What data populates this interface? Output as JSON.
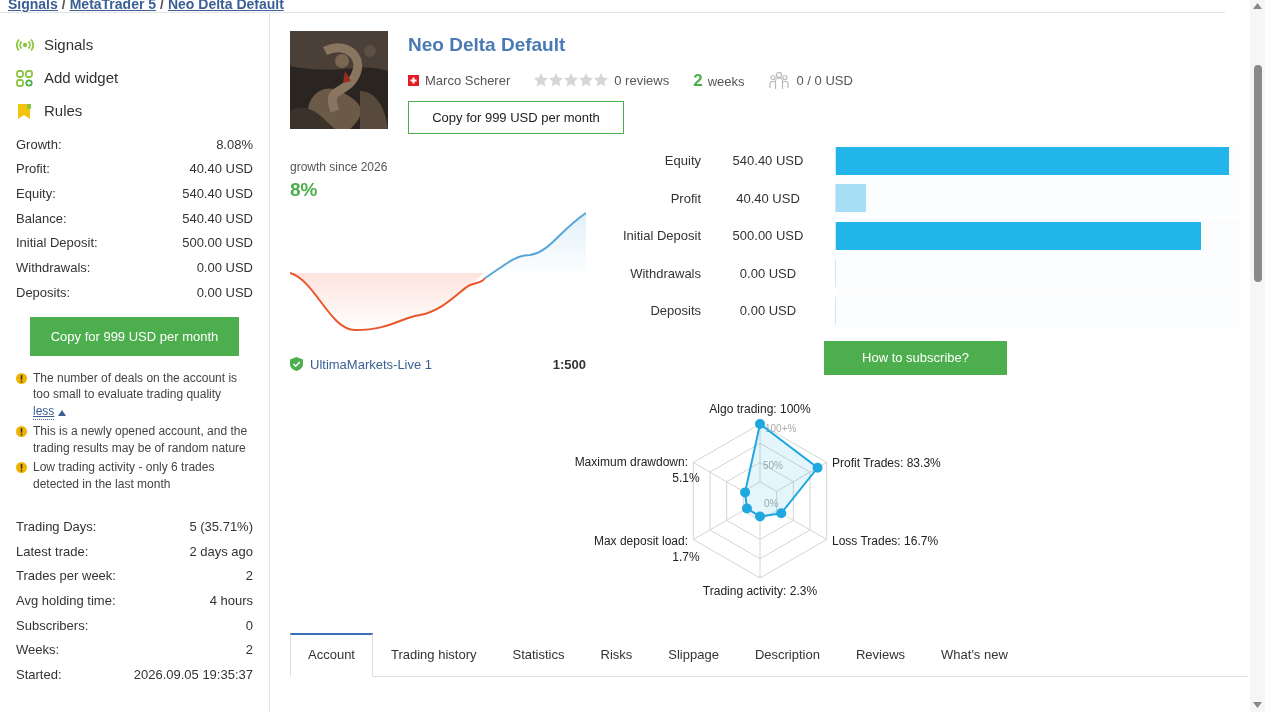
{
  "breadcrumb": {
    "items": [
      "Signals",
      "MetaTrader 5",
      "Neo Delta Default"
    ],
    "separator": "/"
  },
  "sidebar": {
    "nav": [
      {
        "label": "Signals",
        "kind": "signals"
      },
      {
        "label": "Add widget",
        "kind": "widget"
      },
      {
        "label": "Rules",
        "kind": "rules"
      }
    ],
    "stats": [
      {
        "label": "Growth:",
        "value": "8.08%"
      },
      {
        "label": "Profit:",
        "value": "40.40 USD"
      },
      {
        "label": "Equity:",
        "value": "540.40 USD"
      },
      {
        "label": "Balance:",
        "value": "540.40 USD"
      },
      {
        "label": "Initial Deposit:",
        "value": "500.00 USD"
      },
      {
        "label": "Withdrawals:",
        "value": "0.00 USD"
      },
      {
        "label": "Deposits:",
        "value": "0.00 USD"
      }
    ],
    "copy_button": "Copy for 999 USD per month",
    "warnings": [
      {
        "text": "The number of deals on the account is too small to evaluate trading quality",
        "link": "less"
      },
      {
        "text": "This is a newly opened account, and the trading results may be of random nature"
      },
      {
        "text": "Low trading activity - only 6 trades detected in the last month"
      }
    ],
    "details": [
      {
        "label": "Trading Days:",
        "value": "5 (35.71%)"
      },
      {
        "label": "Latest trade:",
        "value": "2 days ago"
      },
      {
        "label": "Trades per week:",
        "value": "2"
      },
      {
        "label": "Avg holding time:",
        "value": "4 hours"
      },
      {
        "label": "Subscribers:",
        "value": "0"
      },
      {
        "label": "Weeks:",
        "value": "2"
      },
      {
        "label": "Started:",
        "value": "2026.09.05 19:35:37"
      }
    ]
  },
  "signal": {
    "title": "Neo Delta Default",
    "author": "Marco Scherer",
    "stars": 0,
    "reviews": "0 reviews",
    "age_number": "2",
    "age_unit": "weeks",
    "subscribers": "0 / 0 USD",
    "copy_button": "Copy for 999 USD per month"
  },
  "growth": {
    "label": "growth since 2026",
    "value": "8%",
    "broker": "UltimaMarkets-Live 1",
    "leverage": "1:500"
  },
  "balance": [
    {
      "label": "Equity",
      "value": "540.40 USD",
      "level": 0.97,
      "color": "#22b5ea"
    },
    {
      "label": "Profit",
      "value": "40.40 USD",
      "level": 0.075,
      "color": "#a6dff5"
    },
    {
      "label": "Initial Deposit",
      "value": "500.00 USD",
      "level": 0.9,
      "color": "#22b5ea"
    },
    {
      "label": "Withdrawals",
      "value": "0.00 USD",
      "level": 0
    },
    {
      "label": "Deposits",
      "value": "0.00 USD",
      "level": 0
    }
  ],
  "subscribe_button": "How to subscribe?",
  "radar": {
    "axes": [
      {
        "label": "Algo trading:",
        "value": "100%"
      },
      {
        "label": "Maximum drawdown:",
        "value": "5.1%"
      },
      {
        "label": "Profit Trades:",
        "value": "83.3%"
      },
      {
        "label": "Max deposit load:",
        "value": "1.7%"
      },
      {
        "label": "Loss Trades:",
        "value": "16.7%"
      },
      {
        "label": "Trading activity:",
        "value": "2.3%"
      }
    ],
    "ring_labels": [
      "100+%",
      "50%",
      "0%"
    ]
  },
  "tabs": [
    {
      "label": "Account",
      "selected": true
    },
    {
      "label": "Trading history",
      "selected": false
    },
    {
      "label": "Statistics",
      "selected": false
    },
    {
      "label": "Risks",
      "selected": false
    },
    {
      "label": "Slippage",
      "selected": false
    },
    {
      "label": "Description",
      "selected": false
    },
    {
      "label": "Reviews",
      "selected": false
    },
    {
      "label": "What's new",
      "selected": false
    }
  ]
}
